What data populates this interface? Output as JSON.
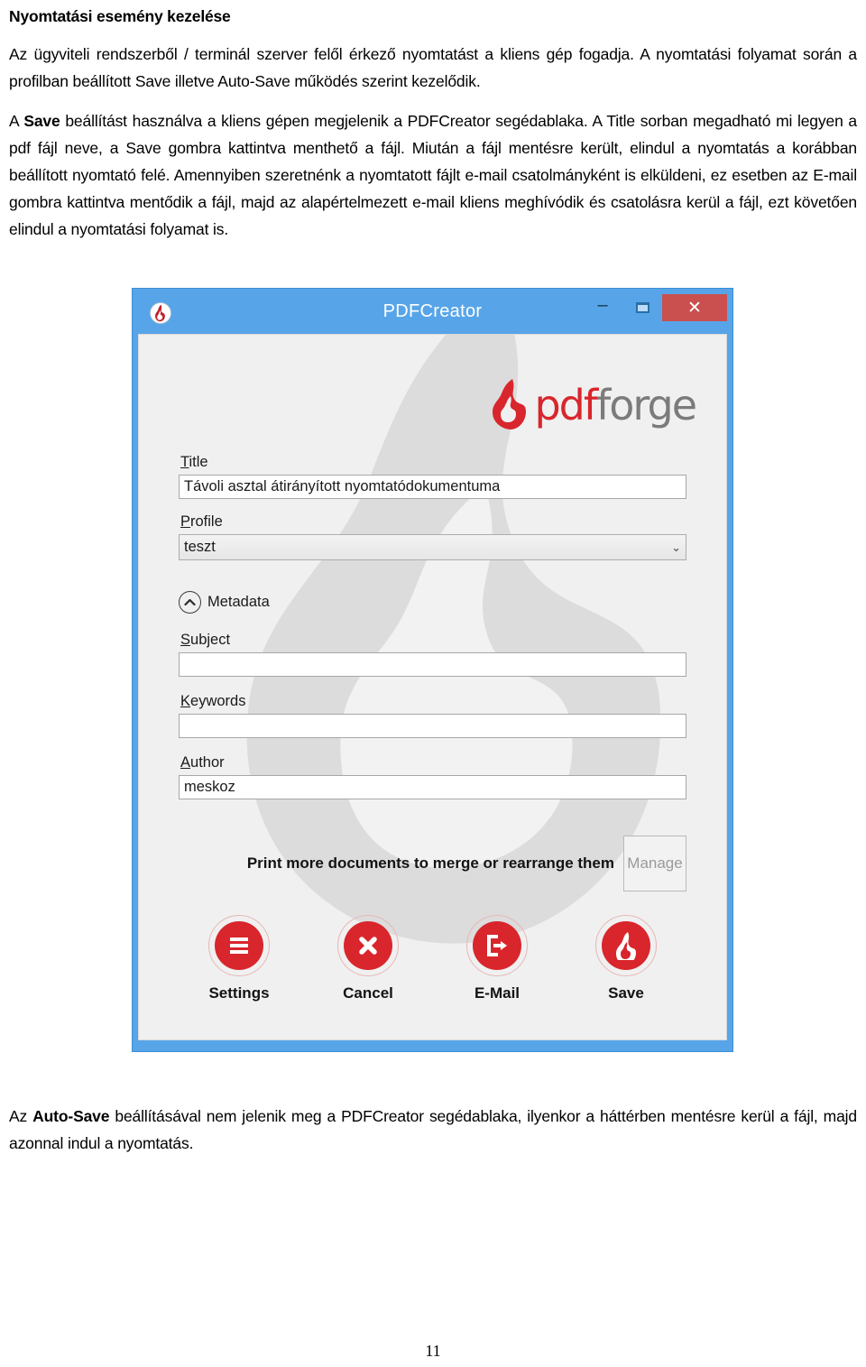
{
  "document": {
    "heading": "Nyomtatási esemény kezelése",
    "paragraph_1": "Az ügyviteli rendszerből / terminál szerver felől érkező nyomtatást a kliens gép fogadja. A nyomtatási folyamat során a profilban beállított Save illetve Auto-Save működés szerint kezelődik.",
    "paragraph_2_pre": "A ",
    "paragraph_2_bold": "Save",
    "paragraph_2_post": " beállítást használva a kliens gépen megjelenik a PDFCreator segédablaka. A Title sorban megadható mi legyen a pdf fájl neve, a Save gombra kattintva menthető a fájl. Miután a fájl mentésre került, elindul a nyomtatás a korábban beállított nyomtató felé. Amennyiben szeretnénk a nyomtatott fájlt e-mail csatolmányként is elküldeni, ez esetben az E-mail gombra kattintva mentődik a fájl, majd az alapértelmezett e-mail kliens meghívódik és csatolásra kerül a fájl, ezt követően elindul a nyomtatási folyamat is.",
    "paragraph_3_pre": "Az ",
    "paragraph_3_bold": "Auto-Save",
    "paragraph_3_post": " beállításával nem jelenik meg a PDFCreator segédablaka, ilyenkor a háttérben mentésre kerül a fájl, majd azonnal indul a nyomtatás.",
    "page_number": "11"
  },
  "dialog": {
    "titlebar": {
      "app_icon": "pdfforge-flame-icon",
      "title": "PDFCreator",
      "minimize_label": "–",
      "maximize_label": "maximize-icon",
      "close_label": "✕",
      "background_color": "#57a5e8",
      "close_color": "#c9504f"
    },
    "brand": {
      "icon": "pdfforge-flame-icon",
      "text_primary": "pdf",
      "text_secondary": "forge",
      "primary_color": "#d8262c",
      "secondary_color": "#7b7b7b"
    },
    "fields": [
      {
        "label": "Title",
        "accelerator": "T",
        "label_rest": "itle",
        "type": "textbox",
        "value": "Távoli asztal átirányított nyomtatódokumentuma",
        "placeholder": ""
      },
      {
        "label": "Profile",
        "accelerator": "P",
        "label_rest": "rofile",
        "type": "combobox",
        "value": "teszt",
        "arrow": "⌄"
      }
    ],
    "metadata": {
      "toggle_icon": "chevron-up-icon",
      "accelerator": "M",
      "label_rest": "etadata",
      "label": "Metadata",
      "expanded": true,
      "fields": [
        {
          "label": "Subject",
          "accelerator": "S",
          "label_rest": "ubject",
          "type": "textbox",
          "value": "",
          "placeholder": ""
        },
        {
          "label": "Keywords",
          "accelerator": "K",
          "label_rest": "eywords",
          "type": "textbox",
          "value": "",
          "placeholder": ""
        },
        {
          "label": "Author",
          "accelerator": "A",
          "label_rest": "uthor",
          "type": "textbox",
          "value": "meskoz",
          "placeholder": ""
        }
      ]
    },
    "merge": {
      "text": "Print more documents to merge or rearrange them",
      "button_label": "Manage",
      "button_enabled": false
    },
    "actions": [
      {
        "label": "Settings",
        "icon": "hamburger-menu-icon",
        "color": "#d8262c"
      },
      {
        "label": "Cancel",
        "icon": "x-circle-icon",
        "color": "#d8262c"
      },
      {
        "label": "E-Mail",
        "icon": "export-arrow-icon",
        "color": "#d8262c"
      },
      {
        "label": "Save",
        "icon": "flame-icon",
        "color": "#d8262c"
      }
    ]
  }
}
